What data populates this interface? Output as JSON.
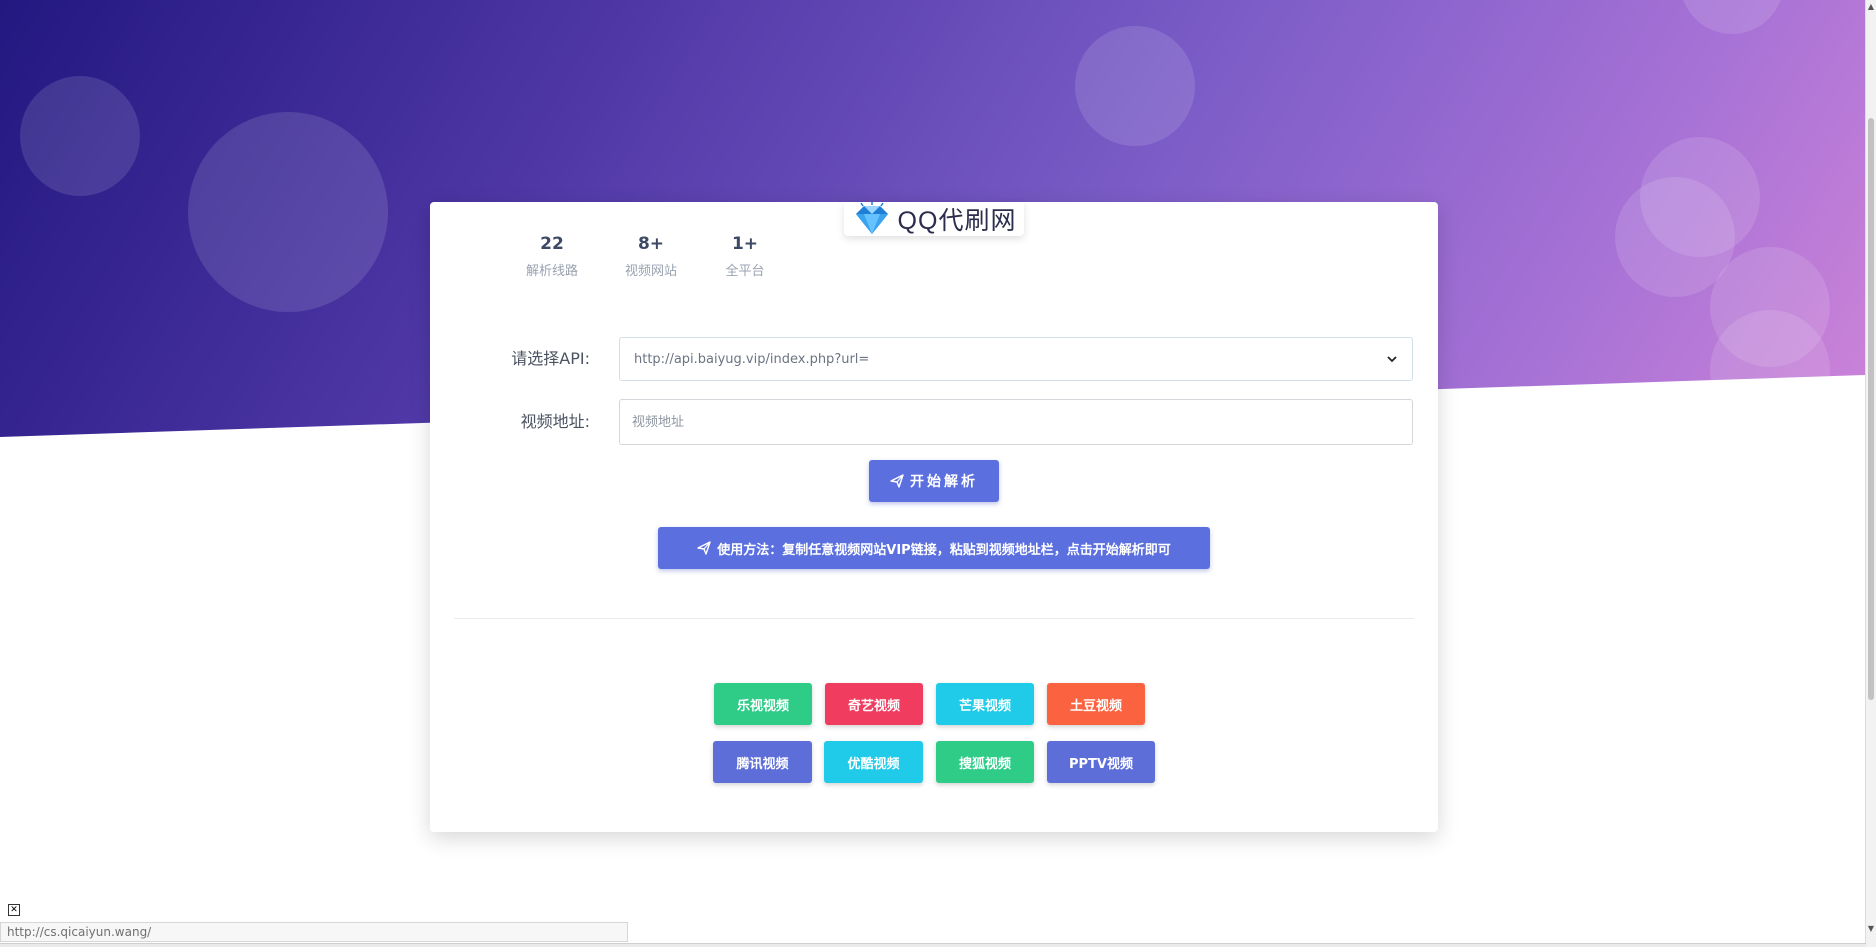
{
  "logo": {
    "text": "QQ代刷网"
  },
  "stats": [
    {
      "number": "22",
      "label": "解析线路"
    },
    {
      "number": "8+",
      "label": "视频网站"
    },
    {
      "number": "1+",
      "label": "全平台"
    }
  ],
  "form": {
    "api_label": "请选择API:",
    "api_selected": "http://api.baiyug.vip/index.php?url=",
    "video_label": "视频地址:",
    "video_placeholder": "视频地址"
  },
  "actions": {
    "parse_label": "开始解析",
    "usage_text": "使用方法：复制任意视频网站VIP链接，粘贴到视频地址栏，点击开始解析即可"
  },
  "video_sites": [
    {
      "label": "乐视视频",
      "color": "#2ecc87"
    },
    {
      "label": "奇艺视频",
      "color": "#f03c5f"
    },
    {
      "label": "芒果视频",
      "color": "#1fcbe8"
    },
    {
      "label": "土豆视频",
      "color": "#fb6340"
    },
    {
      "label": "腾讯视频",
      "color": "#5e6ed9"
    },
    {
      "label": "优酷视频",
      "color": "#1fcbe8"
    },
    {
      "label": "搜狐视频",
      "color": "#2ecc87"
    },
    {
      "label": "PPTV视频",
      "color": "#5e6ed9"
    }
  ],
  "status_bar": {
    "url": "http://cs.qicaiyun.wang/"
  },
  "colors": {
    "primary": "#5b6fdf",
    "hero_start": "#231780",
    "hero_end": "#cf84d8"
  }
}
